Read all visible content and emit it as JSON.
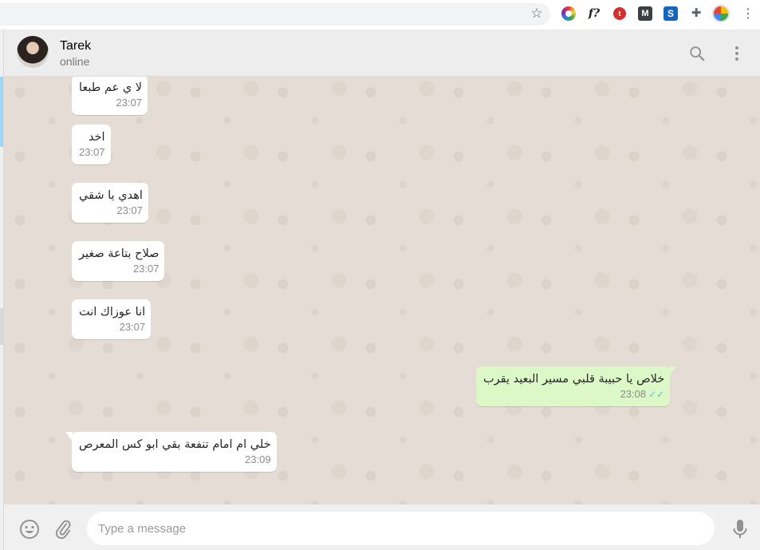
{
  "browser": {
    "icons": [
      "star-icon",
      "color-wheel-icon",
      "font-ext-icon",
      "red-ext-icon",
      "m-ext-icon",
      "s-ext-icon",
      "puzzle-icon",
      "profile-icon",
      "more-icon"
    ],
    "ext_f_label": "f?",
    "ext_m_label": "M",
    "ext_s_label": "S",
    "ext_red_label": "t"
  },
  "header": {
    "name": "Tarek",
    "status": "online"
  },
  "messages": [
    {
      "dir": "in",
      "text": "لا ي عم طبعا",
      "time": "23:07"
    },
    {
      "dir": "in",
      "text": "اخد",
      "time": "23:07"
    },
    {
      "dir": "in",
      "text": "اهدي يا شقي",
      "time": "23:07"
    },
    {
      "dir": "in",
      "text": "صلاح بتاعة صغير",
      "time": "23:07"
    },
    {
      "dir": "in",
      "text": "انا عوزاك انت",
      "time": "23:07"
    },
    {
      "dir": "out",
      "text": "خلاص يا حبيبة قلبي مسير البعيد يقرب",
      "time": "23:08",
      "ticks": "✓✓"
    },
    {
      "dir": "in",
      "text": "خلي ام امام تنفعة بقي ابو كس المعرص",
      "time": "23:09"
    }
  ],
  "compose": {
    "placeholder": "Type a message"
  },
  "colors": {
    "chat_bg": "#e5ddd5",
    "incoming": "#ffffff",
    "outgoing": "#dcf8c6",
    "read_ticks": "#4fc3f7"
  }
}
